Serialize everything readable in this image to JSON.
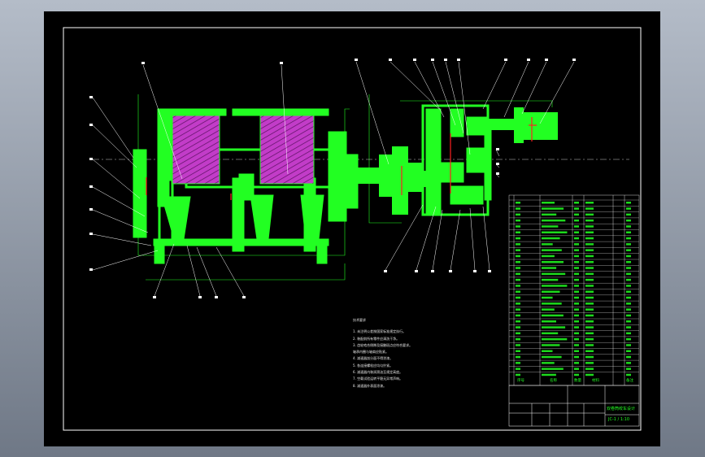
{
  "drawing": {
    "background": "#000000",
    "line_color": "#22ff22",
    "hatch_color": "#c23cc8",
    "red_color": "#ff2020",
    "frame_color": "#ffffff"
  },
  "notes": {
    "title": "技术要求",
    "lines": [
      "1. 未注明公差按国家标准规定执行。",
      "2. 装配前所有零件应清洗干净。",
      "3. 齿轮啮合侧隙及接触斑点应符合要求。",
      "   轴承内圈与轴肩应贴紧。",
      "4. 减速器剖分面不得涂漆。",
      "5. 各连接螺栓应均匀拧紧。",
      "6. 减速器内装润滑油至规定高度。",
      "7. 空载试验运转平稳无异常声响。",
      "8. 减速器外表面涂漆。"
    ]
  },
  "title_block": {
    "drawing_name": "双卷筒绞车设计",
    "drawing_number": "JC-1 / 1:10",
    "header_labels": [
      "序号",
      "名称",
      "数量",
      "材料",
      "备注"
    ]
  }
}
